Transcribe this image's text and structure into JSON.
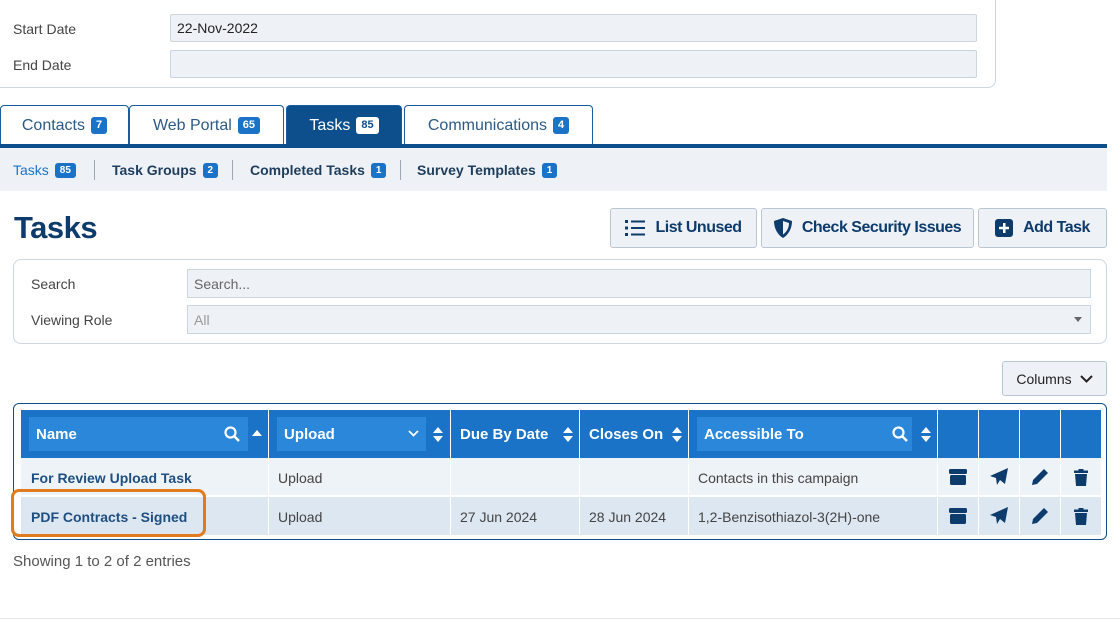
{
  "form": {
    "start_date_label": "Start Date",
    "start_date_value": "22-Nov-2022",
    "end_date_label": "End Date",
    "end_date_value": ""
  },
  "tabs": [
    {
      "label": "Contacts",
      "count": "7",
      "active": false
    },
    {
      "label": "Web Portal",
      "count": "65",
      "active": false
    },
    {
      "label": "Tasks",
      "count": "85",
      "active": true
    },
    {
      "label": "Communications",
      "count": "4",
      "active": false
    }
  ],
  "subtabs": [
    {
      "label": "Tasks",
      "count": "85",
      "active": true
    },
    {
      "label": "Task Groups",
      "count": "2",
      "active": false
    },
    {
      "label": "Completed Tasks",
      "count": "1",
      "active": false
    },
    {
      "label": "Survey Templates",
      "count": "1",
      "active": false
    }
  ],
  "page": {
    "title": "Tasks",
    "list_unused_label": "List Unused",
    "check_security_label": "Check Security Issues",
    "add_task_label": "Add Task"
  },
  "filters": {
    "search_label": "Search",
    "search_placeholder": "Search...",
    "role_label": "Viewing Role",
    "role_value": "All"
  },
  "columns_button": "Columns",
  "table": {
    "headers": [
      "Name",
      "Upload",
      "Due By Date",
      "Closes On",
      "Accessible To"
    ],
    "rows": [
      {
        "name": "For Review Upload Task",
        "type": "Upload",
        "due": "",
        "closes": "",
        "access": "Contacts in this campaign"
      },
      {
        "name": "PDF Contracts - Signed",
        "type": "Upload",
        "due": "27 Jun 2024",
        "closes": "28 Jun 2024",
        "access": "1,2-Benzisothiazol-3(2H)-one"
      }
    ]
  },
  "footer": {
    "info": "Showing 1 to 2 of 2 entries"
  },
  "colors": {
    "primary": "#0d4f8d",
    "header_blue": "#1a73c6",
    "highlight": "#e07b1f"
  },
  "icons": [
    "list-icon",
    "shield-icon",
    "plus-square-icon",
    "chevron-down-icon",
    "search-icon",
    "archive-icon",
    "send-icon",
    "edit-icon",
    "trash-icon"
  ]
}
